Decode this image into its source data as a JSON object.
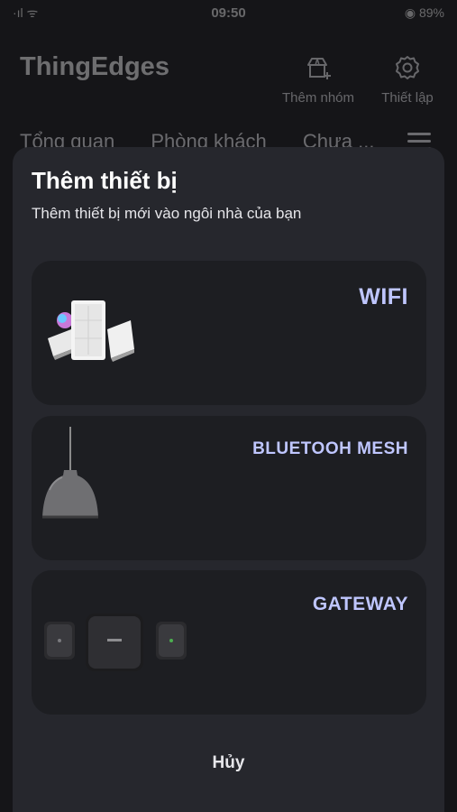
{
  "status_bar": {
    "time": "09:50",
    "left": "·ıl ᯤ",
    "right": "◉ 89%"
  },
  "header": {
    "app_title": "ThingEdges",
    "add_group_label": "Thêm nhóm",
    "settings_label": "Thiết lập"
  },
  "tabs": [
    "Tổng quan",
    "Phòng khách",
    "Chưa ..."
  ],
  "sheet": {
    "title": "Thêm thiết bị",
    "subtitle": "Thêm thiết bị mới vào ngôi nhà của bạn",
    "options": [
      {
        "label": "WIFI"
      },
      {
        "label": "BLUETOOH MESH"
      },
      {
        "label": "GATEWAY"
      }
    ],
    "cancel_label": "Hủy"
  },
  "colors": {
    "accent_label": "#bfc6ff",
    "sheet_bg": "#26272d",
    "card_bg": "#1d1e22",
    "page_bg": "#151518"
  },
  "icons": {
    "add_group": "add-home-icon",
    "settings": "gear-icon",
    "menu": "hamburger-icon"
  }
}
